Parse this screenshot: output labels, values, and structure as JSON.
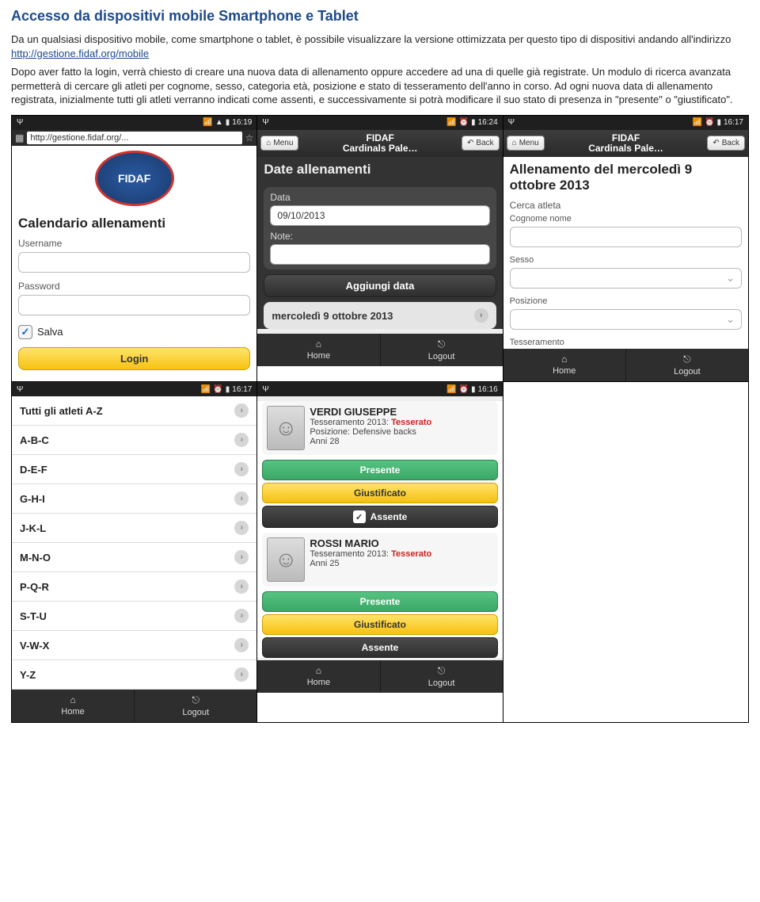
{
  "doc": {
    "title": "Accesso da dispositivi mobile Smartphone e Tablet",
    "p1": "Da un qualsiasi dispositivo mobile, come smartphone o tablet, è possibile visualizzare la versione ottimizzata per questo tipo di dispositivi andando all'indirizzo ",
    "link": "http://gestione.fidaf.org/mobile",
    "p2": "Dopo aver fatto la login, verrà chiesto di creare una nuova data di allenamento oppure accedere ad una di quelle già registrate. Un modulo di ricerca avanzata permetterà di cercare gli atleti per cognome, sesso, categoria età, posizione e stato di tesseramento dell'anno in corso. Ad ogni nuova data di allenamento registrata, inizialmente tutti gli atleti verranno indicati come assenti, e successivamente si potrà modificare il suo stato di presenza in \"presente\" o \"giustificato\"."
  },
  "times": {
    "s1": "16:19",
    "s2": "16:24",
    "s3": "16:17",
    "s4": "16:17",
    "s5": "16:16"
  },
  "url": "http://gestione.fidaf.org/...",
  "logo_text": "FIDAF",
  "header": {
    "menu": "Menu",
    "back": "Back",
    "title_fidaf": "FIDAF",
    "title_team": "Cardinals Pale…"
  },
  "s1": {
    "title": "Calendario allenamenti",
    "username": "Username",
    "password": "Password",
    "salva": "Salva",
    "login": "Login"
  },
  "s2": {
    "title": "Date allenamenti",
    "data_label": "Data",
    "data_value": "09/10/2013",
    "note_label": "Note:",
    "add": "Aggiungi data",
    "item": "mercoledì 9 ottobre 2013"
  },
  "s3": {
    "title": "Allenamento del mercoledì 9 ottobre 2013",
    "search": "Cerca atleta",
    "cognome": "Cognome nome",
    "sesso": "Sesso",
    "posizione": "Posizione",
    "tesseramento": "Tesseramento"
  },
  "s4": {
    "header": "Tutti gli atleti A-Z",
    "rows": [
      "A-B-C",
      "D-E-F",
      "G-H-I",
      "J-K-L",
      "M-N-O",
      "P-Q-R",
      "S-T-U",
      "V-W-X",
      "Y-Z"
    ]
  },
  "s5": {
    "a1_name": "VERDI GIUSEPPE",
    "a1_tess_label": "Tesseramento 2013:",
    "a1_tess_val": "Tesserato",
    "a1_pos": "Posizione: Defensive backs",
    "a1_age": "Anni 28",
    "a2_name": "ROSSI MARIO",
    "a2_tess_label": "Tesseramento 2013:",
    "a2_tess_val": "Tesserato",
    "a2_age": "Anni 25",
    "presente": "Presente",
    "giustificato": "Giustificato",
    "assente": "Assente"
  },
  "footer": {
    "home": "Home",
    "logout": "Logout"
  }
}
